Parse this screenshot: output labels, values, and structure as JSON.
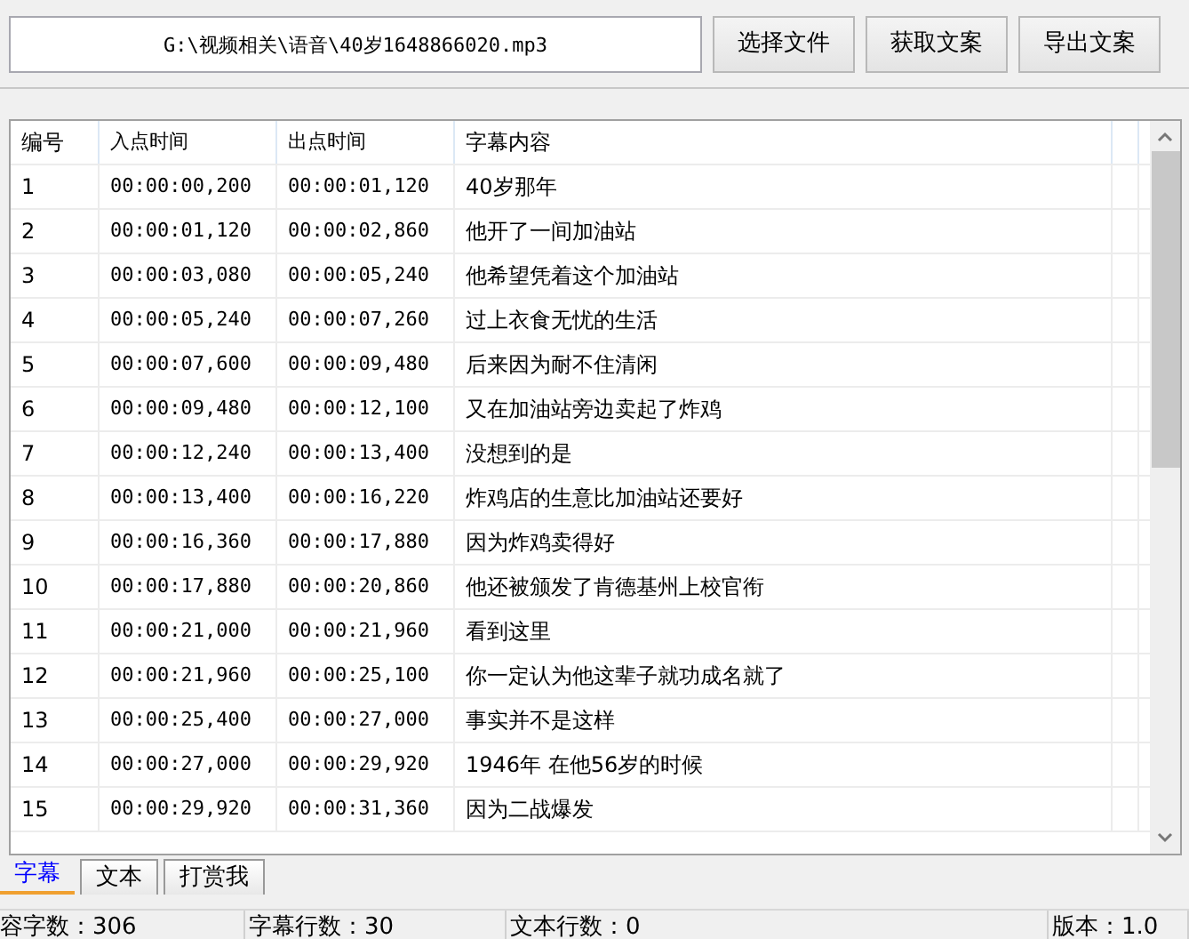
{
  "file_path": "G:\\视频相关\\语音\\40岁1648866020.mp3",
  "buttons": [
    "选择文件",
    "获取文案",
    "导出文案"
  ],
  "table": {
    "columns": [
      "编号",
      "入点时间",
      "出点时间",
      "字幕内容"
    ],
    "rows": [
      [
        "1",
        "00:00:00,200",
        "00:00:01,120",
        "40岁那年"
      ],
      [
        "2",
        "00:00:01,120",
        "00:00:02,860",
        "他开了一间加油站"
      ],
      [
        "3",
        "00:00:03,080",
        "00:00:05,240",
        "他希望凭着这个加油站"
      ],
      [
        "4",
        "00:00:05,240",
        "00:00:07,260",
        "过上衣食无忧的生活"
      ],
      [
        "5",
        "00:00:07,600",
        "00:00:09,480",
        "后来因为耐不住清闲"
      ],
      [
        "6",
        "00:00:09,480",
        "00:00:12,100",
        "又在加油站旁边卖起了炸鸡"
      ],
      [
        "7",
        "00:00:12,240",
        "00:00:13,400",
        "没想到的是"
      ],
      [
        "8",
        "00:00:13,400",
        "00:00:16,220",
        "炸鸡店的生意比加油站还要好"
      ],
      [
        "9",
        "00:00:16,360",
        "00:00:17,880",
        "因为炸鸡卖得好"
      ],
      [
        "10",
        "00:00:17,880",
        "00:00:20,860",
        "他还被颁发了肯德基州上校官衔"
      ],
      [
        "11",
        "00:00:21,000",
        "00:00:21,960",
        "看到这里"
      ],
      [
        "12",
        "00:00:21,960",
        "00:00:25,100",
        "你一定认为他这辈子就功成名就了"
      ],
      [
        "13",
        "00:00:25,400",
        "00:00:27,000",
        "事实并不是这样"
      ],
      [
        "14",
        "00:00:27,000",
        "00:00:29,920",
        "1946年 在他56岁的时候"
      ],
      [
        "15",
        "00:00:29,920",
        "00:00:31,360",
        "因为二战爆发"
      ]
    ]
  },
  "tabs": [
    {
      "label": "字幕",
      "selected": true
    },
    {
      "label": "文本",
      "selected": false
    },
    {
      "label": "打赏我",
      "selected": false
    }
  ],
  "status_bar": [
    "容字数：306",
    "字幕行数：30",
    "文本行数：0",
    "版本：1.0"
  ]
}
